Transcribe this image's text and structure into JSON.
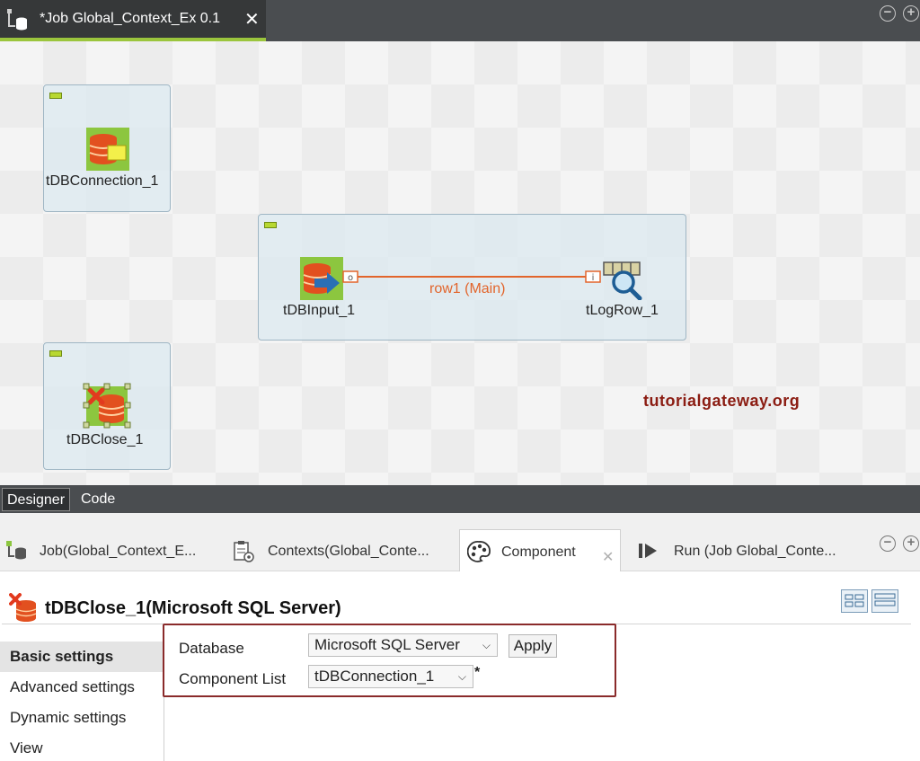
{
  "editor": {
    "tab_title": "*Job Global_Context_Ex 0.1",
    "minimize_symbol": "⊖",
    "maximize_symbol": "⊕"
  },
  "canvas": {
    "components": [
      {
        "label": "tDBConnection_1",
        "icon": "db-connection-icon"
      },
      {
        "label": "tDBInput_1",
        "icon": "db-input-icon"
      },
      {
        "label": "tLogRow_1",
        "icon": "log-row-icon"
      },
      {
        "label": "tDBClose_1",
        "icon": "db-close-icon"
      }
    ],
    "link_label": "row1 (Main)",
    "link_color": "#e2652c",
    "watermark": "tutorialgateway.org"
  },
  "view_tabs": [
    "Designer",
    "Code"
  ],
  "panel_tabs": [
    {
      "label": "Job(Global_Context_E...",
      "icon": "job-icon"
    },
    {
      "label": "Contexts(Global_Conte...",
      "icon": "contexts-icon"
    },
    {
      "label": "Component",
      "icon": "palette-icon"
    },
    {
      "label": "Run (Job Global_Conte...",
      "icon": "run-icon"
    }
  ],
  "component_header": {
    "title": "tDBClose_1(Microsoft SQL Server)"
  },
  "settings_nav": [
    "Basic settings",
    "Advanced settings",
    "Dynamic settings",
    "View"
  ],
  "settings": {
    "database_label": "Database",
    "database_value": "Microsoft SQL Server",
    "apply_label": "Apply",
    "component_list_label": "Component List",
    "component_list_value": "tDBConnection_1",
    "dirty_marker": "*"
  },
  "colors": {
    "accent_green": "#9bc53d",
    "highlight_border": "#8a2b2b",
    "watermark": "#8b1c12"
  }
}
